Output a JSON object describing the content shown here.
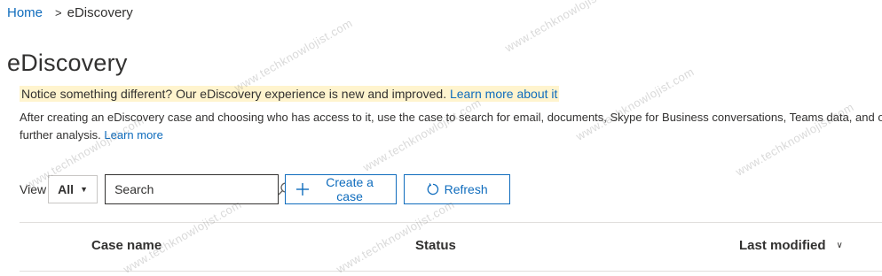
{
  "breadcrumb": {
    "home": "Home",
    "separator": ">",
    "current": "eDiscovery"
  },
  "page": {
    "title": "eDiscovery"
  },
  "notice": {
    "text": "Notice something different? Our eDiscovery experience is new and improved. ",
    "link": "Learn more about it"
  },
  "description": {
    "line1": "After creating an eDiscovery case and choosing who has access to it, use the case to search for email, documents, Skype for Business conversations, Teams data, and othe",
    "line2_prefix": "further analysis. ",
    "learn_more": "Learn more"
  },
  "toolbar": {
    "view_label": "View",
    "view_value": "All",
    "search_placeholder": "Search",
    "create_label": "Create a case",
    "refresh_label": "Refresh"
  },
  "table": {
    "columns": [
      "Case name",
      "Status",
      "Last modified"
    ]
  },
  "watermark": {
    "text": "www.techknowlojist.com"
  },
  "colors": {
    "accent": "#0f6cbd",
    "notice_bg": "#fff4ce",
    "text": "#323130"
  },
  "icons": {
    "search": "search-icon",
    "create": "plus-icon",
    "refresh": "refresh-icon",
    "dropdown": "chevron-down-icon",
    "sort": "chevron-down-icon"
  }
}
